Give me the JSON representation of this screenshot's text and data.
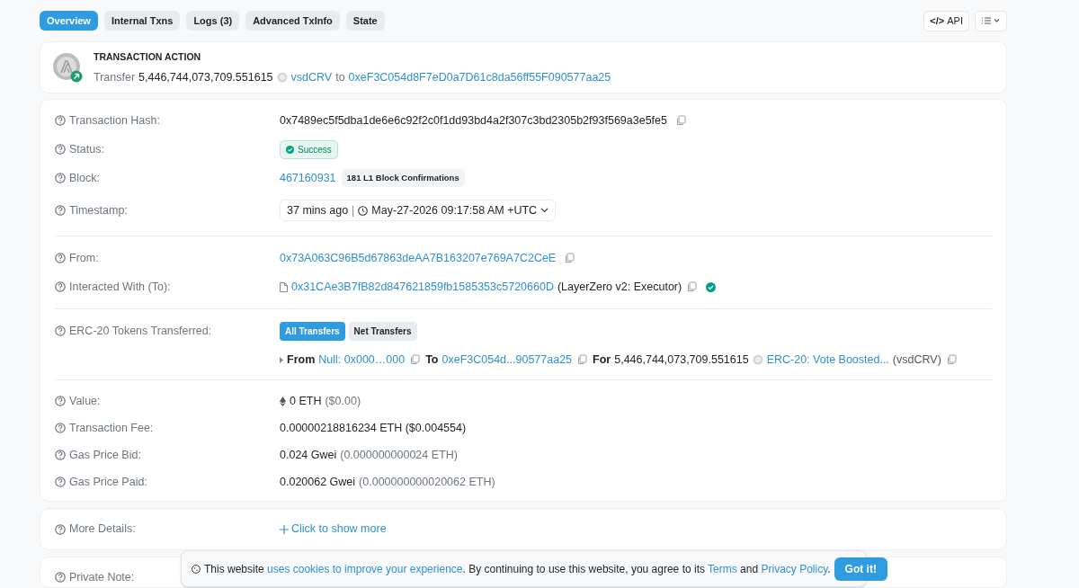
{
  "tabs": [
    {
      "label": "Overview",
      "selected": true
    },
    {
      "label": "Internal Txns",
      "selected": false
    },
    {
      "label": "Logs (3)",
      "selected": false
    },
    {
      "label": "Advanced TxInfo",
      "selected": false
    },
    {
      "label": "State",
      "selected": false
    }
  ],
  "api_button": {
    "icon": "</>",
    "label": "API"
  },
  "action": {
    "heading": "TRANSACTION ACTION",
    "verb": "Transfer",
    "amount": "5,446,744,073,709.551615",
    "token": "vsdCRV",
    "connector": "to",
    "address": "0xeF3C054d8F7eD0a7D61c8da56ff55F090577aa25"
  },
  "sections": [
    [
      {
        "kind": "copyable",
        "label": "Transaction Hash:",
        "value": "0x7489ec5f5dba1de6e6c92f2c0f1dd93bd4a2f307c3bd2305b2f93f569a3e5fe5"
      },
      {
        "kind": "status",
        "label": "Status:",
        "value": "Success"
      },
      {
        "kind": "block",
        "label": "Block:",
        "value": "467160931",
        "badge": "181 L1 Block Confirmations"
      },
      {
        "kind": "timestamp",
        "label": "Timestamp:",
        "age": "37 mins ago",
        "separator": "|",
        "date": "May-27-2026 09:17:58 AM +UTC"
      }
    ],
    [
      {
        "kind": "address",
        "label": "From:",
        "value": "0x73A063C96B5d67863deAA7B163207e769A7C2CeE"
      },
      {
        "kind": "contract",
        "label": "Interacted With (To):",
        "value": "0x31CAe3B7fB82d847621859fb1585353c5720660D",
        "name": "(LayerZero v2: Executor)",
        "verified": true
      }
    ],
    [
      {
        "kind": "transfers",
        "label": "ERC-20 Tokens Transferred:",
        "filters": [
          {
            "label": "All Transfers",
            "selected": true
          },
          {
            "label": "Net Transfers",
            "selected": false
          }
        ],
        "transfer": {
          "from_label": "From",
          "from": "Null: 0x000…000",
          "to_label": "To",
          "to": "0xeF3C054d...90577aa25",
          "for_label": "For",
          "amount": "5,446,744,073,709.551615",
          "token": "ERC-20: Vote Boosted...",
          "symbol": "(vsdCRV)"
        }
      }
    ],
    [
      {
        "kind": "eth",
        "label": "Value:",
        "value": "0 ETH",
        "secondary": "($0.00)"
      },
      {
        "kind": "amount",
        "label": "Transaction Fee:",
        "value": "0.00000218816234 ETH ($0.004554)"
      },
      {
        "kind": "amount",
        "label": "Gas Price Bid:",
        "value": "0.024 Gwei",
        "secondary": "(0.000000000024 ETH)"
      },
      {
        "kind": "amount",
        "label": "Gas Price Paid:",
        "value": "0.020062 Gwei",
        "secondary": "(0.000000000020062 ETH)"
      }
    ]
  ],
  "more_details": {
    "label": "More Details:",
    "link": "Click to show more"
  },
  "private_note": {
    "label": "Private Note:"
  },
  "cookie_banner": {
    "parts": [
      {
        "text": "This website ",
        "link": false
      },
      {
        "text": "uses cookies to improve your experience",
        "link": true
      },
      {
        "text": ". By continuing to use this website, you agree to its ",
        "link": false
      },
      {
        "text": "Terms",
        "link": true
      },
      {
        "text": " and ",
        "link": false
      },
      {
        "text": "Privacy Policy",
        "link": true
      },
      {
        "text": ".",
        "link": false
      }
    ],
    "button": "Got it!"
  }
}
